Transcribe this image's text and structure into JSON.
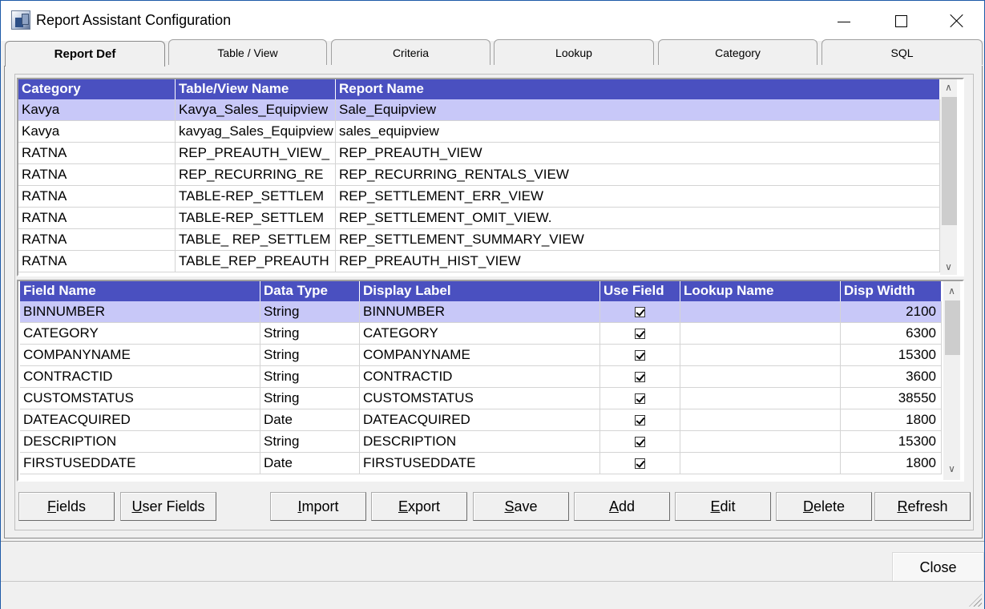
{
  "window": {
    "title": "Report Assistant Configuration"
  },
  "tabs": [
    {
      "label": "Report Def",
      "active": true
    },
    {
      "label": "Table / View"
    },
    {
      "label": "Criteria"
    },
    {
      "label": "Lookup"
    },
    {
      "label": "Category"
    },
    {
      "label": "SQL"
    }
  ],
  "reports_grid": {
    "columns": [
      "Category",
      "Table/View Name",
      "Report Name"
    ],
    "rows": [
      [
        "Kavya",
        "Kavya_Sales_Equipview",
        "Sale_Equipview"
      ],
      [
        "Kavya",
        "kavyag_Sales_Equipview",
        "sales_equipview"
      ],
      [
        "RATNA",
        "REP_PREAUTH_VIEW_",
        "REP_PREAUTH_VIEW"
      ],
      [
        "RATNA",
        "REP_RECURRING_RE",
        "REP_RECURRING_RENTALS_VIEW"
      ],
      [
        "RATNA",
        "TABLE-REP_SETTLEM",
        "REP_SETTLEMENT_ERR_VIEW"
      ],
      [
        "RATNA",
        "TABLE-REP_SETTLEM",
        "REP_SETTLEMENT_OMIT_VIEW."
      ],
      [
        "RATNA",
        "TABLE_ REP_SETTLEM",
        "REP_SETTLEMENT_SUMMARY_VIEW"
      ],
      [
        "RATNA",
        "TABLE_REP_PREAUTH",
        "REP_PREAUTH_HIST_VIEW"
      ]
    ],
    "selected_row": 0
  },
  "fields_grid": {
    "columns": [
      "Field Name",
      "Data Type",
      "Display Label",
      "Use Field",
      "Lookup Name",
      "Disp Width"
    ],
    "rows": [
      [
        "BINNUMBER",
        "String",
        "BINNUMBER",
        true,
        "",
        "2100"
      ],
      [
        "CATEGORY",
        "String",
        "CATEGORY",
        true,
        "",
        "6300"
      ],
      [
        "COMPANYNAME",
        "String",
        "COMPANYNAME",
        true,
        "",
        "15300"
      ],
      [
        "CONTRACTID",
        "String",
        "CONTRACTID",
        true,
        "",
        "3600"
      ],
      [
        "CUSTOMSTATUS",
        "String",
        "CUSTOMSTATUS",
        true,
        "",
        "38550"
      ],
      [
        "DATEACQUIRED",
        "Date",
        "DATEACQUIRED",
        true,
        "",
        "1800"
      ],
      [
        "DESCRIPTION",
        "String",
        "DESCRIPTION",
        true,
        "",
        "15300"
      ],
      [
        "FIRSTUSEDDATE",
        "Date",
        "FIRSTUSEDDATE",
        true,
        "",
        "1800"
      ]
    ],
    "selected_row": 0
  },
  "buttons": {
    "fields": {
      "pre": "",
      "u": "F",
      "post": "ields"
    },
    "user_fields": {
      "pre": "",
      "u": "U",
      "post": "ser Fields"
    },
    "import": {
      "pre": "",
      "u": "I",
      "post": "mport"
    },
    "export": {
      "pre": "",
      "u": "E",
      "post": "xport"
    },
    "save": {
      "pre": "",
      "u": "S",
      "post": "ave"
    },
    "add": {
      "pre": "",
      "u": "A",
      "post": "dd"
    },
    "edit": {
      "pre": "",
      "u": "E",
      "post": "dit"
    },
    "delete": {
      "pre": "",
      "u": "D",
      "post": "elete"
    },
    "refresh": {
      "pre": "",
      "u": "R",
      "post": "efresh"
    },
    "close": {
      "pre": "",
      "u": "C",
      "post": "lose"
    }
  },
  "icons": {
    "app": "report-app-icon",
    "scroll_up": "chevron-up-icon",
    "scroll_down": "chevron-down-icon"
  },
  "colors": {
    "header_bg": "#4a50c0",
    "selected_row_bg": "#c8c8f8"
  }
}
